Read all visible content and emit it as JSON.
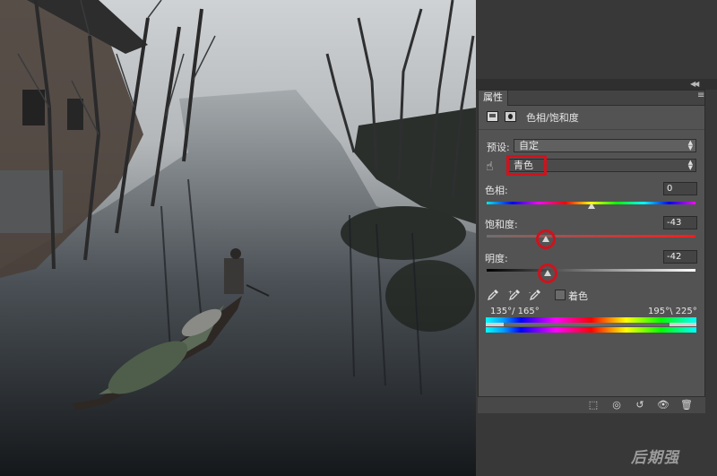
{
  "panel": {
    "tab": "属性",
    "title": "色相/饱和度",
    "preset_label": "预设:",
    "preset_value": "自定",
    "channel_value": "青色",
    "hue_label": "色相:",
    "hue_value": "0",
    "saturation_label": "饱和度:",
    "saturation_value": "-43",
    "lightness_label": "明度:",
    "lightness_value": "-42",
    "colorize_label": "着色",
    "range_left": "135°/ 165°",
    "range_right": "195°\\ 225°"
  },
  "slider_levels": {
    "hue": 0,
    "saturation": -43,
    "lightness": -42
  },
  "icons": {
    "panel_header": [
      "adjustment-icon",
      "mask-icon"
    ],
    "channel": "hand-targeted-adjust-icon",
    "eyedroppers": [
      "eyedropper-icon",
      "eyedropper-plus-icon",
      "eyedropper-minus-icon"
    ],
    "bottom": [
      "clip-to-layer-icon",
      "visibility-preview-icon",
      "reset-icon",
      "eye-icon",
      "trash-icon"
    ]
  },
  "watermark": "后期强"
}
